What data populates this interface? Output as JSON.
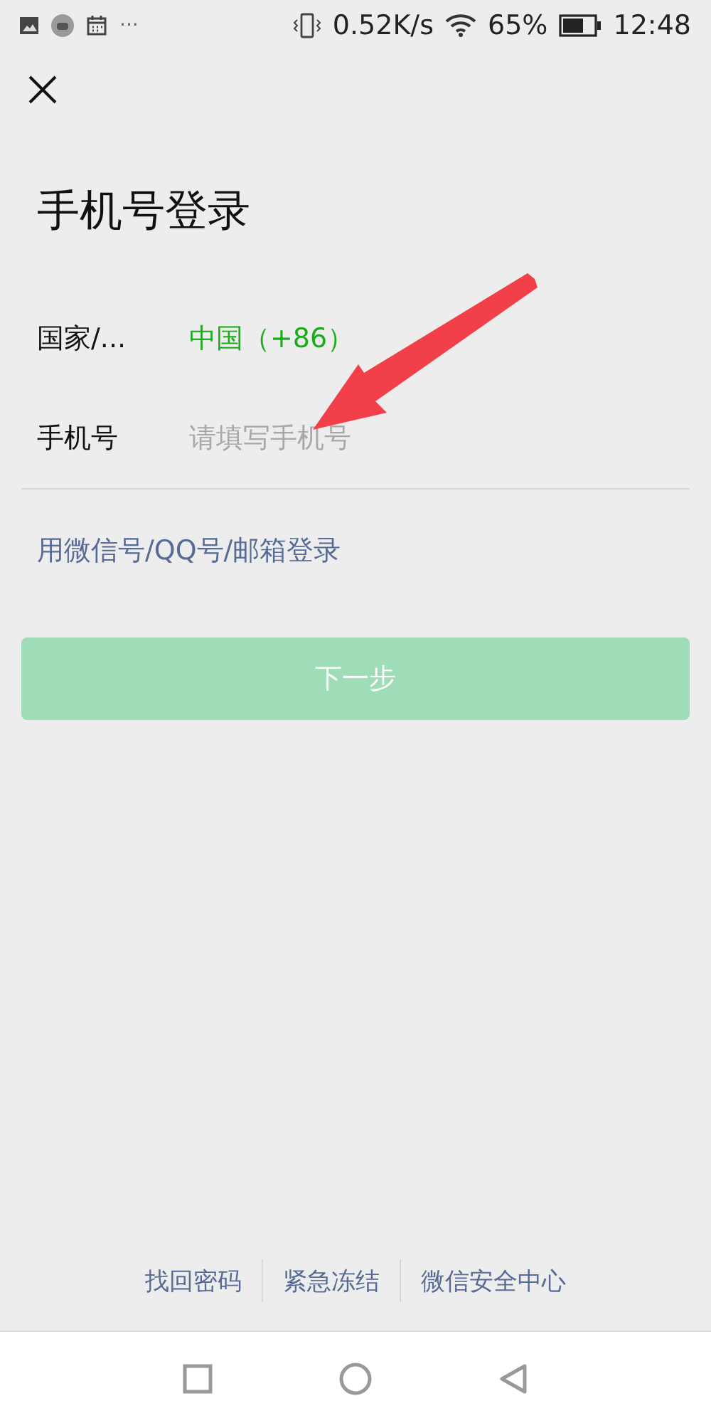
{
  "status_bar": {
    "more": "···",
    "speed": "0.52K/s",
    "battery": "65%",
    "time": "12:48"
  },
  "title": "手机号登录",
  "fields": [
    {
      "label": "国家/...",
      "kind": "value",
      "value": "中国（+86）"
    },
    {
      "label": "手机号",
      "kind": "input",
      "placeholder": "请填写手机号"
    }
  ],
  "alt_login_link": "用微信号/QQ号/邮箱登录",
  "next_button": {
    "label": "下一步",
    "disabled": true
  },
  "footer_links": [
    "找回密码",
    "紧急冻结",
    "微信安全中心"
  ],
  "annotation": {
    "kind": "arrow"
  }
}
